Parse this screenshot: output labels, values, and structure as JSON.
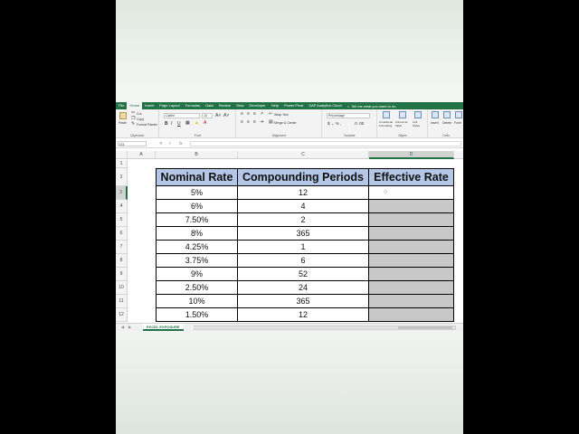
{
  "ribbon": {
    "tabs": [
      "File",
      "Home",
      "Insert",
      "Page Layout",
      "Formulas",
      "Data",
      "Review",
      "View",
      "Developer",
      "Help",
      "Power Pivot",
      "SAP Analytics Cloud"
    ],
    "active_tab": "Home",
    "tell_me": "Tell me what you want to do",
    "clipboard": {
      "paste": "Paste",
      "cut": "Cut",
      "copy": "Copy",
      "format_painter": "Format Painter",
      "label": "Clipboard"
    },
    "font": {
      "name": "Calibri",
      "size": "16",
      "bold": "B",
      "italic": "I",
      "underline": "U",
      "label": "Font"
    },
    "alignment": {
      "wrap_text": "Wrap Text",
      "merge_center": "Merge & Center",
      "label": "Alignment"
    },
    "number": {
      "format": "Percentage",
      "label": "Number"
    },
    "styles": {
      "conditional": "Conditional Formatting",
      "format_table": "Format as Table",
      "cell_styles": "Cell Styles",
      "label": "Styles"
    },
    "cells": {
      "insert": "Insert",
      "delete": "Delete",
      "format": "Form",
      "label": "Cells"
    }
  },
  "formula_bar": {
    "name_box": "D3",
    "fx": "fx",
    "value": ""
  },
  "columns": [
    "A",
    "B",
    "C",
    "D"
  ],
  "selected_column": "D",
  "rows": [
    "1",
    "2",
    "3",
    "4",
    "5",
    "6",
    "7",
    "8",
    "9",
    "10",
    "11",
    "12"
  ],
  "selected_row": "3",
  "table": {
    "headers": [
      "Nominal Rate",
      "Compounding Periods",
      "Effective Rate"
    ],
    "rows": [
      [
        "5%",
        "12"
      ],
      [
        "6%",
        "4"
      ],
      [
        "7.50%",
        "2"
      ],
      [
        "8%",
        "365"
      ],
      [
        "4.25%",
        "1"
      ],
      [
        "3.75%",
        "6"
      ],
      [
        "9%",
        "52"
      ],
      [
        "2.50%",
        "24"
      ],
      [
        "10%",
        "365"
      ],
      [
        "1.50%",
        "12"
      ]
    ]
  },
  "sheet_tab": "EXCEL EXPOSURE",
  "colors": {
    "ribbon_green": "#217346",
    "header_fill": "#b4c7e7",
    "empty_fill": "#c8c8c8"
  }
}
